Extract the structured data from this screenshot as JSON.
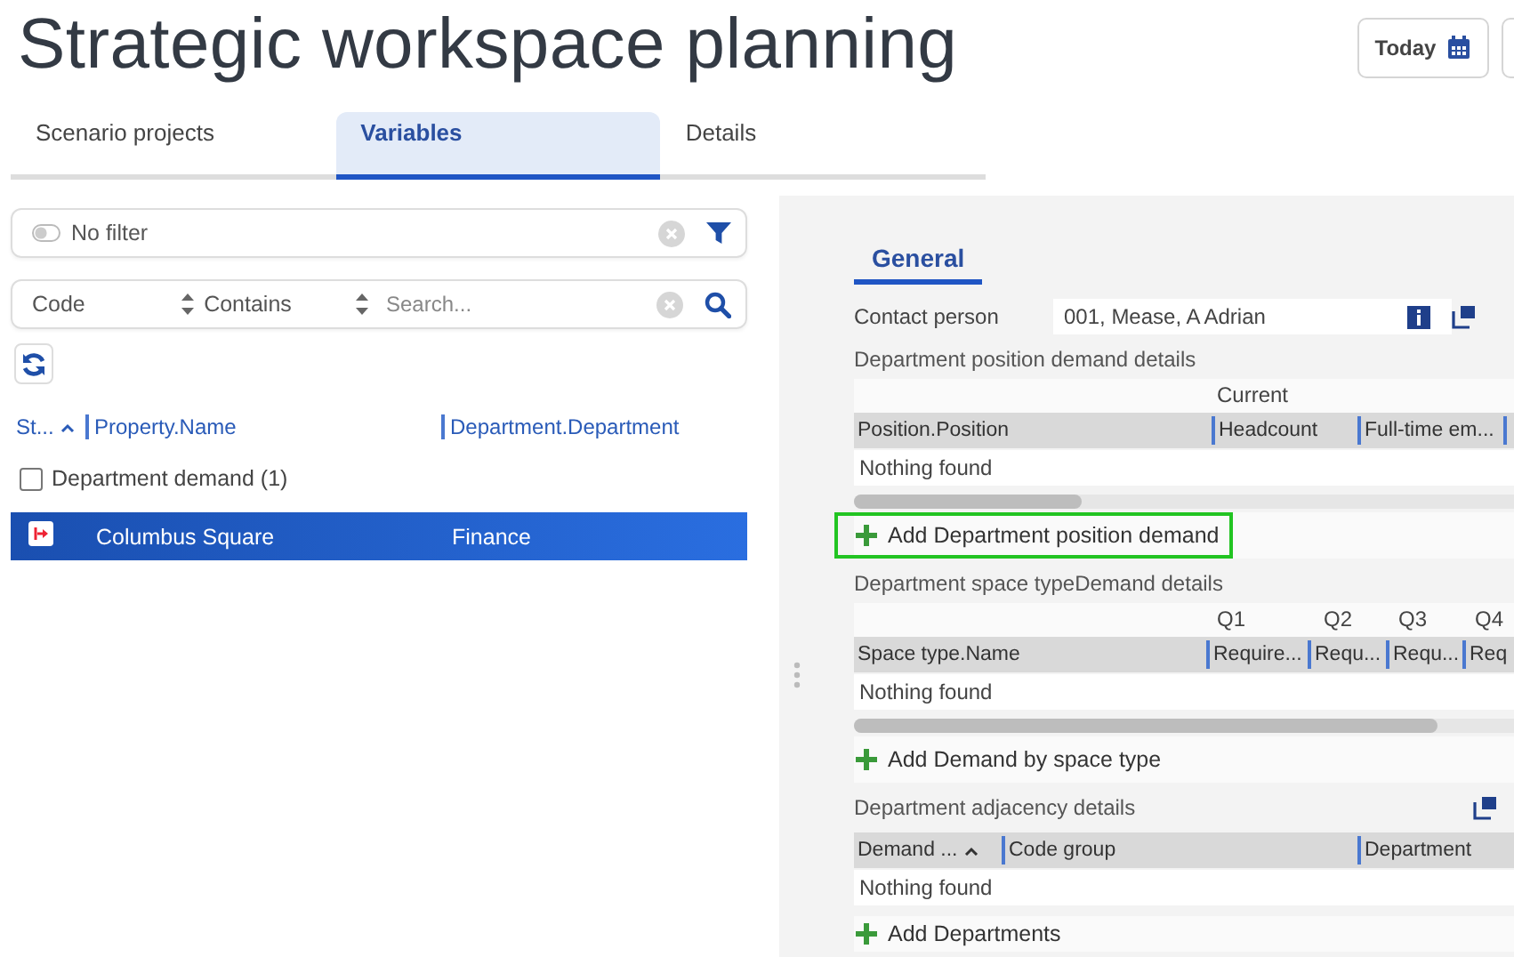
{
  "title": "Strategic workspace planning",
  "toolbar": {
    "today_button": "Today"
  },
  "tabs": [
    {
      "label": "Scenario projects",
      "selected": false
    },
    {
      "label": "Variables",
      "selected": true
    },
    {
      "label": "Details",
      "selected": false
    }
  ],
  "list_panel": {
    "filter": {
      "label": "No filter",
      "enabled": false
    },
    "search": {
      "field": "Code",
      "operator": "Contains",
      "placeholder": "Search..."
    },
    "columns": [
      {
        "label": "St...",
        "sorted": true
      },
      {
        "label": "Property.Name",
        "sorted": false
      },
      {
        "label": "Department.Department",
        "sorted": false
      }
    ],
    "groups": [
      {
        "label": "Department demand (1)",
        "checked": false,
        "rows": [
          {
            "cells": [
              "Columbus Square",
              "Finance"
            ],
            "selected": true
          }
        ]
      }
    ]
  },
  "detail_panel": {
    "tabs": [
      {
        "label": "General",
        "selected": true
      }
    ],
    "contact_person": {
      "label": "Contact person",
      "value": "001, Mease, A Adrian"
    },
    "sections": [
      {
        "title": "Department position demand details",
        "group_headers": [
          "Current"
        ],
        "columns": [
          {
            "label": "Position.Position",
            "sorted": false
          },
          {
            "label": "Headcount",
            "sorted": false
          },
          {
            "label": "Full-time em...",
            "sorted": false
          }
        ],
        "empty_text": "Nothing found",
        "add_button": {
          "label": "Add Department position demand",
          "highlighted": true
        }
      },
      {
        "title": "Department space typeDemand details",
        "group_headers": [
          "Q1",
          "Q2",
          "Q3",
          "Q4"
        ],
        "columns": [
          {
            "label": "Space type.Name",
            "sorted": false
          },
          {
            "label": "Require...",
            "sorted": false
          },
          {
            "label": "Requ...",
            "sorted": false
          },
          {
            "label": "Requ...",
            "sorted": false
          },
          {
            "label": "Req",
            "sorted": false
          }
        ],
        "empty_text": "Nothing found",
        "add_button": {
          "label": "Add Demand by space type",
          "highlighted": false
        }
      },
      {
        "title": "Department adjacency details",
        "columns": [
          {
            "label": "Demand ...",
            "sorted": true
          },
          {
            "label": "Code group",
            "sorted": false
          },
          {
            "label": "Department",
            "sorted": false
          }
        ],
        "empty_text": "Nothing found",
        "add_button": {
          "label": "Add Departments",
          "highlighted": false
        }
      }
    ]
  }
}
